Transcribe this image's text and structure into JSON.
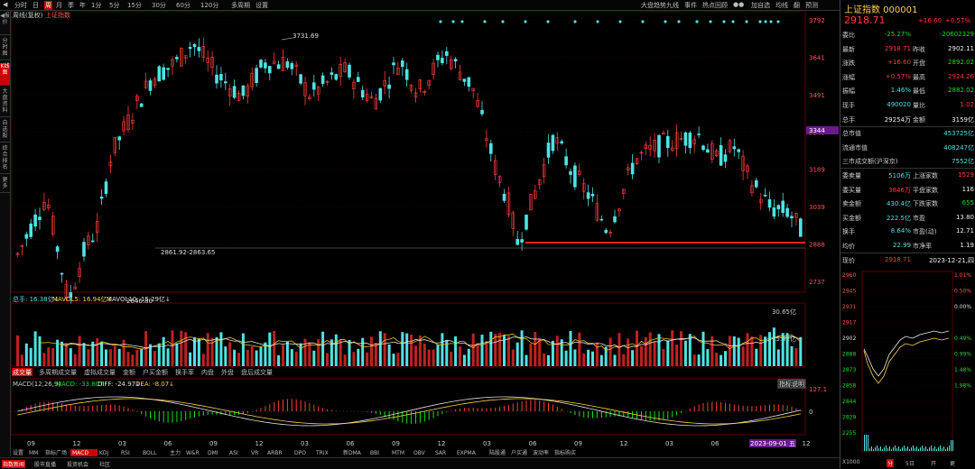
{
  "topbar": {
    "items": [
      "◀",
      "分时",
      "日",
      "周",
      "月",
      "季",
      "年",
      "1分",
      "5分",
      "15分",
      "30分",
      "60分",
      "120分",
      "多周期",
      "设置"
    ],
    "active_index": 3,
    "right_items": [
      "大盘趋势九线",
      "事件",
      "热点回顾",
      "●●",
      "加自选",
      "均线",
      "翻",
      "预测"
    ]
  },
  "left_strip": [
    "◀报价",
    "分时图",
    "K线图",
    "大盘资料",
    "自选股",
    "综合排名",
    "更多"
  ],
  "left_active": 2,
  "chart": {
    "legend": "周线(复权)",
    "legend2": "上证指数",
    "price_axis": [
      "3792",
      "3641",
      "3491",
      "3340",
      "3189",
      "3039",
      "2888",
      "2737"
    ],
    "current_price_tag": "3344",
    "annotations": {
      "high": "3731.69",
      "low": "2646.80",
      "range": "2861.92-2863.65"
    },
    "volume_legend": [
      "总手: 16.38亿↓",
      "MAVOL5: 16.94亿↓",
      "MAVOL10: 15.29亿↓"
    ],
    "volume_axis": [
      "30.65亿",
      "15.32亿"
    ],
    "vol_tabs": [
      "成交量",
      "多周期成交量",
      "虚拟成交量",
      "金额",
      "户买金额",
      "换手率",
      "内盘",
      "外盘",
      "盘后成交量"
    ],
    "macd_legend": [
      "MACD(12,26,9)",
      "MACD: -33.80↑",
      "DIFF: -24.97↓",
      "DEA: -8.07↓"
    ],
    "macd_axis": [
      "127.1",
      "0",
      "-127.1"
    ],
    "indicator_btn": "指标说明",
    "x_labels": [
      "09",
      "12",
      "03",
      "06",
      "09",
      "12",
      "03",
      "06",
      "09",
      "12",
      "03",
      "06",
      "09",
      "12",
      "03",
      "06",
      "09",
      "12"
    ],
    "x_highlight": "2023-09-01 五",
    "ind_tabs": [
      "设置",
      "MM",
      "指标广场",
      "MACD",
      "KDJ",
      "RSI",
      "BOLL",
      "主力",
      "W&R",
      "DMI",
      "ASI",
      "VR",
      "ARBR",
      "DPO",
      "TRIX",
      "新DMA",
      "BBI",
      "MTM",
      "OBV",
      "SAR",
      "EXPMA",
      "陆股通",
      "户买通",
      "波动率",
      "指标购买"
    ],
    "ind_active": 3
  },
  "bottom_bar": [
    "指数新闻",
    "股市直播",
    "投资机会",
    "社区"
  ],
  "right_panel": {
    "title": "上证指数 000001",
    "price": "2918.71",
    "change": "+16.60",
    "change_pct": "+0.57%",
    "rows": [
      {
        "l1": "委比",
        "v1": "-25.27%",
        "c1": "green",
        "l2": "",
        "v2": "-20602329",
        "c2": "green"
      },
      {
        "l1": "最新",
        "v1": "2918.71",
        "c1": "red",
        "l2": "昨收",
        "v2": "2902.11",
        "c2": "white"
      },
      {
        "l1": "涨跌",
        "v1": "+16.60",
        "c1": "red",
        "l2": "开盘",
        "v2": "2892.02",
        "c2": "green"
      },
      {
        "l1": "涨幅",
        "v1": "+0.57%",
        "c1": "red",
        "l2": "最高",
        "v2": "2924.26",
        "c2": "red"
      },
      {
        "l1": "振幅",
        "v1": "1.46%",
        "c1": "cyan",
        "l2": "最低",
        "v2": "2882.02",
        "c2": "green"
      },
      {
        "l1": "现手",
        "v1": "490020",
        "c1": "cyan",
        "l2": "量比",
        "v2": "1.02",
        "c2": "red"
      },
      {
        "l1": "总手",
        "v1": "29254万",
        "c1": "white",
        "l2": "金额",
        "v2": "3159亿",
        "c2": "white"
      },
      {
        "l1": "总市值",
        "v1": "",
        "c1": "white",
        "l2": "",
        "v2": "453725亿",
        "c2": "cyan"
      },
      {
        "l1": "流通市值",
        "v1": "",
        "c1": "white",
        "l2": "",
        "v2": "408247亿",
        "c2": "cyan"
      },
      {
        "l1": "三市成交额(沪深京)",
        "v1": "",
        "c1": "white",
        "l2": "",
        "v2": "7552亿",
        "c2": "cyan"
      },
      {
        "l1": "委卖量",
        "v1": "5106万",
        "c1": "cyan",
        "l2": "上涨家数",
        "v2": "1529",
        "c2": "red"
      },
      {
        "l1": "委买量",
        "v1": "3846万",
        "c1": "red",
        "l2": "平盘家数",
        "v2": "116",
        "c2": "white"
      },
      {
        "l1": "卖金额",
        "v1": "430.4亿",
        "c1": "cyan",
        "l2": "下跌家数",
        "v2": "655",
        "c2": "green"
      },
      {
        "l1": "买金额",
        "v1": "222.5亿",
        "c1": "cyan",
        "l2": "市盈",
        "v2": "13.80",
        "c2": "white"
      },
      {
        "l1": "换手",
        "v1": "8.64%",
        "c1": "cyan",
        "l2": "市盈(动)",
        "v2": "12.71",
        "c2": "white"
      },
      {
        "l1": "均价",
        "v1": "22.99",
        "c1": "cyan",
        "l2": "市净率",
        "v2": "1.19",
        "c2": "white"
      },
      {
        "l1": "现价",
        "v1": "2918.71",
        "c1": "red",
        "l2": "",
        "v2": "2023-12-21,四",
        "c2": "white"
      }
    ],
    "mini_left_axis": [
      "2960",
      "2945",
      "2931",
      "2917",
      "2902",
      "2888",
      "2873",
      "2858",
      "2844",
      "2829",
      "2255"
    ],
    "mini_right_axis": [
      "1.01%",
      "0.50%",
      "0.00%",
      "0.49%",
      "0.99%",
      "1.48%",
      "1.98%"
    ],
    "mini_bottom": [
      "X1000",
      "分",
      "5日",
      "开",
      "更"
    ]
  },
  "colors": {
    "up": "#ff3b3b",
    "down": "#4fe3e3",
    "grid": "#3a0000",
    "ma5": "#e0e0e0",
    "ma10": "#e8c020",
    "panel_bg": "#000000"
  }
}
